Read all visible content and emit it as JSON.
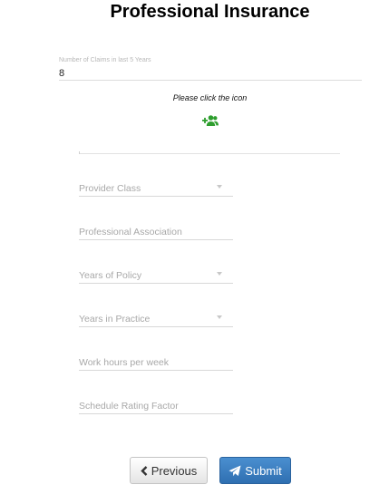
{
  "page": {
    "title": "Professional Insurance"
  },
  "claims": {
    "label": "Number of Claims in last 5 Years",
    "value": "8"
  },
  "instruction": "Please click the icon",
  "icons": {
    "add": "add-user-icon",
    "add_color": "#2e9e2e",
    "prev": "chevron-left-icon",
    "submit": "paper-plane-icon"
  },
  "fields": [
    {
      "label": "Provider Class",
      "type": "select"
    },
    {
      "label": "Professional Association",
      "type": "text"
    },
    {
      "label": "Years of Policy",
      "type": "select"
    },
    {
      "label": "Years in Practice",
      "type": "select"
    },
    {
      "label": "Work hours per week",
      "type": "text"
    },
    {
      "label": "Schedule Rating Factor",
      "type": "text"
    }
  ],
  "buttons": {
    "previous": "Previous",
    "submit": "Submit"
  }
}
